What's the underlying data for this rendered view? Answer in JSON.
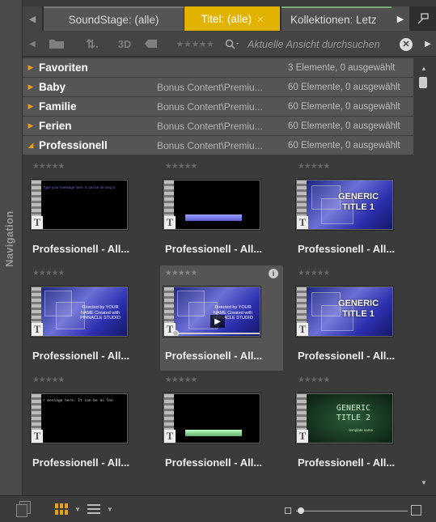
{
  "nav": {
    "label": "Navigation"
  },
  "tabs": [
    {
      "label": "SoundStage: (alle)"
    },
    {
      "label": "Titel: (alle)",
      "close": "×"
    },
    {
      "label": "Kollektionen: Letz"
    }
  ],
  "toolbar": {
    "sort": "⇅.",
    "three_d": "3D",
    "stars": "★★★★★",
    "search_placeholder": "Aktuelle Ansicht durchsuchen",
    "search_clear": "✕"
  },
  "collections": [
    {
      "name": "Favoriten",
      "path": "",
      "count": "3 Elemente, 0 ausgewählt",
      "expanded": false
    },
    {
      "name": "Baby",
      "path": "Bonus Content\\Premiu...",
      "count": "60 Elemente, 0 ausgewählt",
      "expanded": false
    },
    {
      "name": "Familie",
      "path": "Bonus Content\\Premiu...",
      "count": "60 Elemente, 0 ausgewählt",
      "expanded": false
    },
    {
      "name": "Ferien",
      "path": "Bonus Content\\Premiu...",
      "count": "60 Elemente, 0 ausgewählt",
      "expanded": false
    },
    {
      "name": "Professionell",
      "path": "Bonus Content\\Premiu...",
      "count": "60 Elemente, 0 ausgewählt",
      "expanded": true
    }
  ],
  "items": [
    {
      "label": "Professionell - All...",
      "stars": "★★★★★",
      "thumb": "text-blue",
      "thumb_text": "Type your message here. It can be as long a"
    },
    {
      "label": "Professionell - All...",
      "stars": "★★★★★",
      "thumb": "lower-third",
      "thumb_text": ""
    },
    {
      "label": "Professionell - All...",
      "stars": "★★★★★",
      "thumb": "generic1",
      "thumb_text": "GENERIC TITLE 1"
    },
    {
      "label": "Professionell - All...",
      "stars": "★★★★★",
      "thumb": "credits",
      "thumb_text": "Directed by YOUR NAME Created with PINNACLE STUDIO"
    },
    {
      "label": "Professionell - All...",
      "stars": "★★★★★",
      "thumb": "credits",
      "thumb_text": "Directed by YOUR NAME Created with PINNACLE STUDIO",
      "selected": true,
      "info": "i",
      "play": "▶"
    },
    {
      "label": "Professionell - All...",
      "stars": "★★★★★",
      "thumb": "generic1",
      "thumb_text": "GENERIC TITLE 1"
    },
    {
      "label": "Professionell - All...",
      "stars": "★★★★★",
      "thumb": "mono",
      "thumb_text": "r message here. It can be as lon"
    },
    {
      "label": "Professionell - All...",
      "stars": "★★★★★",
      "thumb": "lower-green",
      "thumb_text": ""
    },
    {
      "label": "Professionell - All...",
      "stars": "★★★★★",
      "thumb": "generic2",
      "thumb_text": "GENERIC TITLE 2",
      "thumb_sub": "template name"
    }
  ],
  "colors": {
    "accent": "#e2b200",
    "caret": "#e89c20"
  }
}
